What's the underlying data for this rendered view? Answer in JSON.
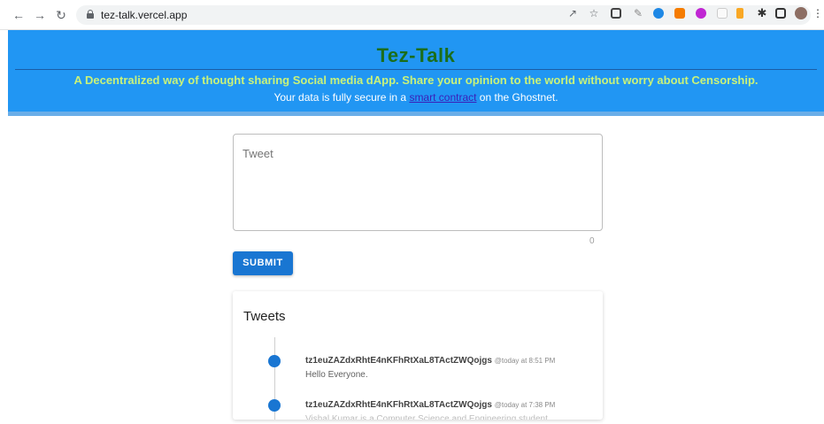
{
  "browser": {
    "url": "tez-talk.vercel.app",
    "icons": [
      "share-icon",
      "star-icon",
      "qr-icon",
      "pen-icon",
      "shield-icon",
      "metamask-icon",
      "pink-circle-icon",
      "extension-square-icon",
      "key-icon",
      "puzzle-icon",
      "sidebar-icon",
      "avatar-icon"
    ]
  },
  "header": {
    "title": "Tez-Talk",
    "tagline": "A Decentralized way of thought sharing Social media dApp. Share your opinion to the world without worry about Censorship.",
    "secure_prefix": "Your data is fully secure in a ",
    "secure_link": "smart contract",
    "secure_suffix": " on the Ghostnet."
  },
  "form": {
    "placeholder": "Tweet",
    "char_count": "0",
    "submit_label": "SUBMIT"
  },
  "tweets": {
    "title": "Tweets",
    "items": [
      {
        "author": "tz1euZAZdxRhtE4nKFhRtXaL8TActZWQojgs",
        "time": "@today at 8:51 PM",
        "text": "Hello Everyone."
      },
      {
        "author": "tz1euZAZdxRhtE4nKFhRtXaL8TActZWQojgs",
        "time": "@today at 7:38 PM",
        "text": "Vishal Kumar is a Computer Science and Engineering student"
      }
    ]
  },
  "colors": {
    "banner": "#2196f3",
    "title": "#1b6e1b",
    "tagline": "#c9f27a",
    "primary": "#1976d2"
  }
}
